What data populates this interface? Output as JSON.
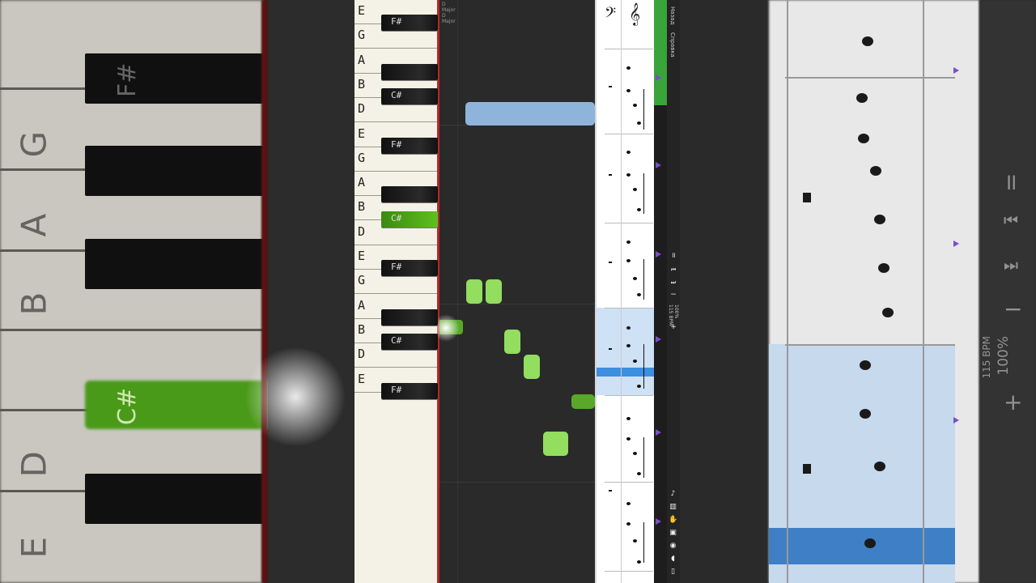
{
  "background_left": {
    "white_labels": [
      "G",
      "A",
      "B",
      "D",
      "E"
    ],
    "black_labels": [
      "F#",
      "C#"
    ]
  },
  "keyboard": {
    "keys": [
      {
        "type": "white",
        "label": "E"
      },
      {
        "type": "black",
        "label": "F#"
      },
      {
        "type": "white",
        "label": "G"
      },
      {
        "type": "white",
        "label": "A"
      },
      {
        "type": "black",
        "label": ""
      },
      {
        "type": "white",
        "label": "B"
      },
      {
        "type": "black",
        "label": "C#"
      },
      {
        "type": "white",
        "label": "D"
      },
      {
        "type": "white",
        "label": "E"
      },
      {
        "type": "black",
        "label": "F#"
      },
      {
        "type": "white",
        "label": "G"
      },
      {
        "type": "white",
        "label": "A"
      },
      {
        "type": "black",
        "label": ""
      },
      {
        "type": "white",
        "label": "B"
      },
      {
        "type": "black",
        "label": "C#"
      },
      {
        "type": "white",
        "label": "D"
      },
      {
        "type": "white",
        "label": "E"
      },
      {
        "type": "black",
        "label": "F#"
      },
      {
        "type": "white",
        "label": "G"
      },
      {
        "type": "white",
        "label": "A"
      },
      {
        "type": "black",
        "label": ""
      },
      {
        "type": "white",
        "label": "B"
      },
      {
        "type": "black",
        "label": "C#"
      },
      {
        "type": "white",
        "label": "D"
      },
      {
        "type": "white",
        "label": "E"
      },
      {
        "type": "black",
        "label": "F#"
      }
    ]
  },
  "roll": {
    "key_signature": [
      "D",
      "Major",
      "D",
      "Major"
    ],
    "colors": {
      "blue_note": "#8eb4dc",
      "light_green": "#93dd5f",
      "dark_green": "#59a829",
      "active_key": "#5fbf20"
    }
  },
  "toolbar": {
    "back_label": "Назад",
    "help_label": "Справка",
    "tempo_percent": "100%",
    "tempo_bpm": "115 BPM",
    "plus": "+",
    "minus": "−",
    "pause": "॥"
  },
  "progress": {
    "fraction": 0.18
  },
  "background_right": {
    "tempo_percent": "100%",
    "tempo_bpm": "115 BPM",
    "plus": "+",
    "minus": "−"
  }
}
